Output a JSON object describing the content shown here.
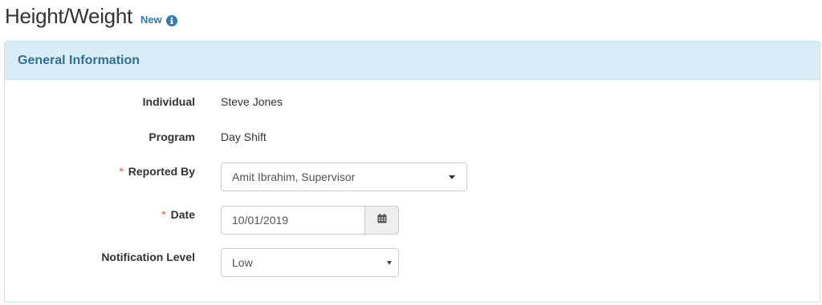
{
  "header": {
    "title": "Height/Weight",
    "status": "New",
    "info_icon": "info-circle-icon"
  },
  "panel": {
    "title": "General Information"
  },
  "fields": {
    "individual": {
      "label": "Individual",
      "value": "Steve Jones"
    },
    "program": {
      "label": "Program",
      "value": "Day Shift"
    },
    "reported_by": {
      "required_marker": "*",
      "label": "Reported By",
      "value": "Amit Ibrahim, Supervisor",
      "icon": "caret-down-icon"
    },
    "date": {
      "required_marker": "*",
      "label": "Date",
      "value": "10/01/2019",
      "icon": "calendar-icon"
    },
    "notification_level": {
      "label": "Notification Level",
      "value": "Low",
      "icon": "caret-down-icon"
    }
  },
  "colors": {
    "panel_heading_bg": "#d9edf7",
    "panel_border": "#bce8f1",
    "panel_title": "#31708f",
    "accent": "#337ab7",
    "required": "#d9534f"
  }
}
